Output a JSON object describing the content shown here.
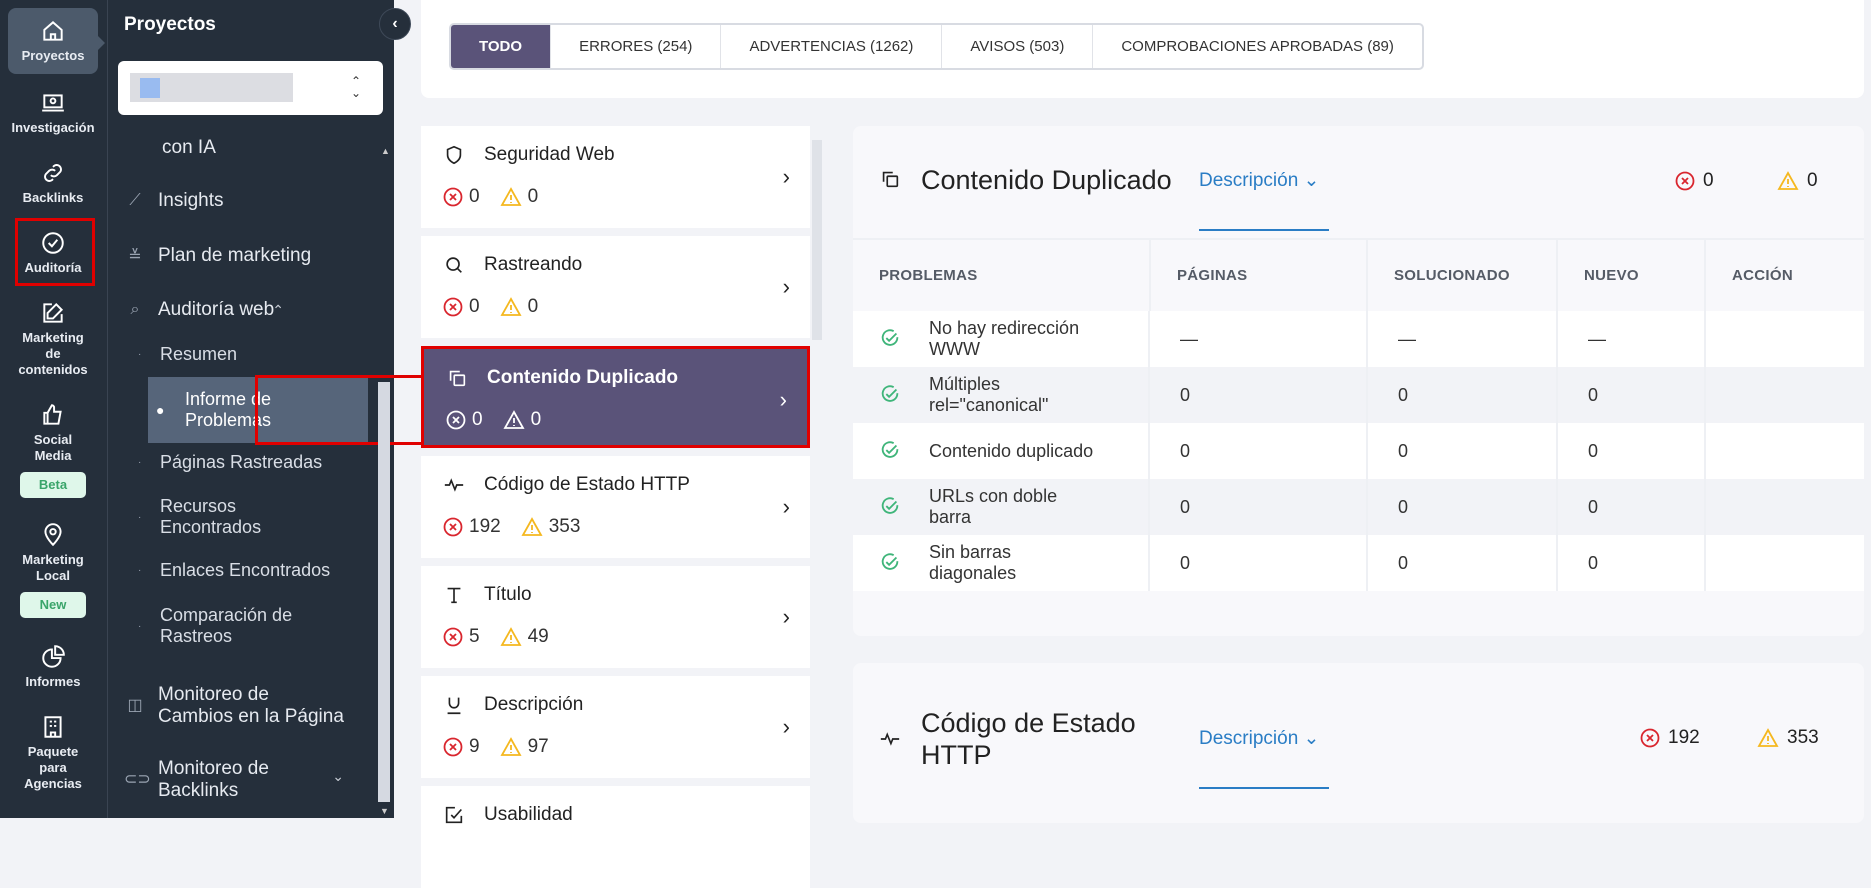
{
  "rail": {
    "items": [
      {
        "label": "Proyectos",
        "icon": "home-icon",
        "active": true
      },
      {
        "label": "Investigación",
        "icon": "laptop-search-icon"
      },
      {
        "label": "Backlinks",
        "icon": "link-icon"
      },
      {
        "label": "Auditoría",
        "icon": "check-circle-icon",
        "highlighted": true
      },
      {
        "label": "Marketing de contenidos",
        "icon": "edit-icon"
      },
      {
        "label": "Social Media",
        "icon": "thumbs-up-icon",
        "badge": "Beta"
      },
      {
        "label": "Marketing Local",
        "icon": "map-pin-icon",
        "badge": "New"
      },
      {
        "label": "Informes",
        "icon": "pie-chart-icon"
      },
      {
        "label": "Paquete para Agencias",
        "icon": "building-icon"
      }
    ]
  },
  "sidebar": {
    "title": "Proyectos",
    "collapse_icon": "chevron-left-icon",
    "project_selector": {
      "value": "[blurred project name]"
    },
    "items": [
      {
        "label": "con IA"
      },
      {
        "label": "Insights",
        "icon": "sparkline-icon"
      },
      {
        "label": "Plan de marketing",
        "icon": "checklist-icon"
      },
      {
        "label": "Auditoría web",
        "icon": "search-box-icon",
        "expanded": true
      }
    ],
    "subitems": [
      {
        "label": "Resumen"
      },
      {
        "label": "Informe de Problemas",
        "active": true
      },
      {
        "label": "Páginas Rastreadas"
      },
      {
        "label": "Recursos Encontrados"
      },
      {
        "label": "Enlaces Encontrados"
      },
      {
        "label": "Comparación de Rastreos"
      }
    ],
    "bottom_items": [
      {
        "label": "Monitoreo de Cambios en la Página",
        "icon": "compare-icon"
      },
      {
        "label": "Monitoreo de Backlinks",
        "icon": "link-icon"
      }
    ]
  },
  "tabs": [
    {
      "label": "TODO",
      "active": true
    },
    {
      "label": "ERRORES (254)"
    },
    {
      "label": "ADVERTENCIAS (1262)"
    },
    {
      "label": "AVISOS (503)"
    },
    {
      "label": "COMPROBACIONES APROBADAS (89)"
    }
  ],
  "categories": [
    {
      "name": "Seguridad Web",
      "icon": "shield-icon",
      "errors": "0",
      "warnings": "0"
    },
    {
      "name": "Rastreando",
      "icon": "search-icon",
      "errors": "0",
      "warnings": "0"
    },
    {
      "name": "Contenido Duplicado",
      "icon": "copy-icon",
      "errors": "0",
      "warnings": "0",
      "active": true
    },
    {
      "name": "Código de Estado HTTP",
      "icon": "pulse-icon",
      "errors": "192",
      "warnings": "353"
    },
    {
      "name": "Título",
      "icon": "text-icon",
      "errors": "5",
      "warnings": "49"
    },
    {
      "name": "Descripción",
      "icon": "underline-icon",
      "errors": "9",
      "warnings": "97"
    },
    {
      "name": "Usabilidad",
      "icon": "edit-box-icon"
    }
  ],
  "panels": [
    {
      "title": "Contenido Duplicado",
      "description_label": "Descripción",
      "errors": "0",
      "warnings": "0",
      "columns": [
        "PROBLEMAS",
        "PÁGINAS",
        "SOLUCIONADO",
        "NUEVO",
        "ACCIÓN"
      ],
      "rows": [
        {
          "problem": "No hay redirección WWW",
          "pages": "—",
          "fixed": "—",
          "new": "—",
          "action": ""
        },
        {
          "problem": "Múltiples rel=\"canonical\"",
          "pages": "0",
          "fixed": "0",
          "new": "0",
          "action": ""
        },
        {
          "problem": "Contenido duplicado",
          "pages": "0",
          "fixed": "0",
          "new": "0",
          "action": ""
        },
        {
          "problem": "URLs con doble barra",
          "pages": "0",
          "fixed": "0",
          "new": "0",
          "action": ""
        },
        {
          "problem": "Sin barras diagonales",
          "pages": "0",
          "fixed": "0",
          "new": "0",
          "action": ""
        }
      ]
    },
    {
      "title": "Código de Estado HTTP",
      "description_label": "Descripción",
      "errors": "192",
      "warnings": "353"
    }
  ],
  "colors": {
    "accent": "#5a5379",
    "error": "#d9262e",
    "warning": "#f5b81f",
    "success": "#3fb57a",
    "link": "#2a7dc5",
    "highlight_box": "#e00000"
  }
}
